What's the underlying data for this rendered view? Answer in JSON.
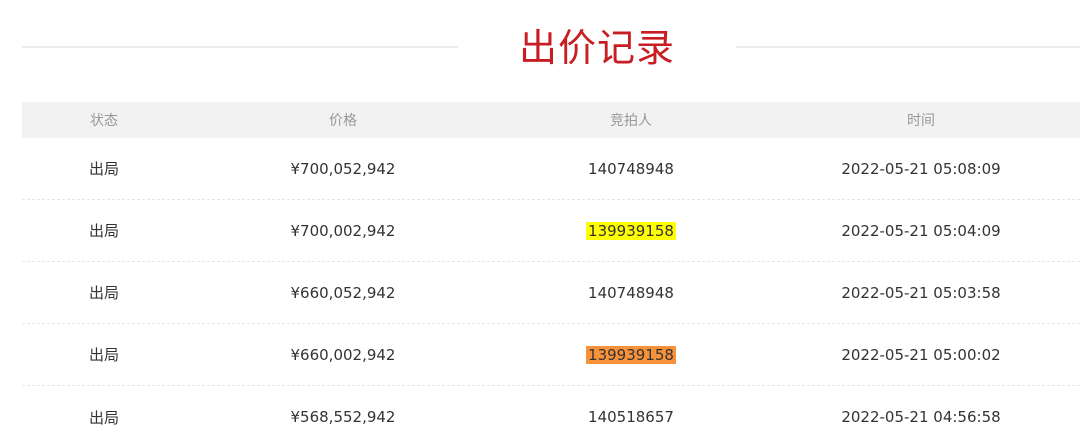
{
  "title": "出价记录",
  "columns": {
    "status": "状态",
    "price": "价格",
    "bidder": "竞拍人",
    "time": "时间"
  },
  "rows": [
    {
      "status": "出局",
      "price": "¥700,052,942",
      "bidder": "140748948",
      "time": "2022-05-21 05:08:09",
      "highlight": ""
    },
    {
      "status": "出局",
      "price": "¥700,002,942",
      "bidder": "139939158",
      "time": "2022-05-21 05:04:09",
      "highlight": "#ffff00"
    },
    {
      "status": "出局",
      "price": "¥660,052,942",
      "bidder": "140748948",
      "time": "2022-05-21 05:03:58",
      "highlight": ""
    },
    {
      "status": "出局",
      "price": "¥660,002,942",
      "bidder": "139939158",
      "time": "2022-05-21 05:00:02",
      "highlight": "#f7923a"
    },
    {
      "status": "出局",
      "price": "¥568,552,942",
      "bidder": "140518657",
      "time": "2022-05-21 04:56:58",
      "highlight": ""
    }
  ],
  "colors": {
    "title": "#c81e23",
    "header_bg": "#f2f2f2"
  }
}
